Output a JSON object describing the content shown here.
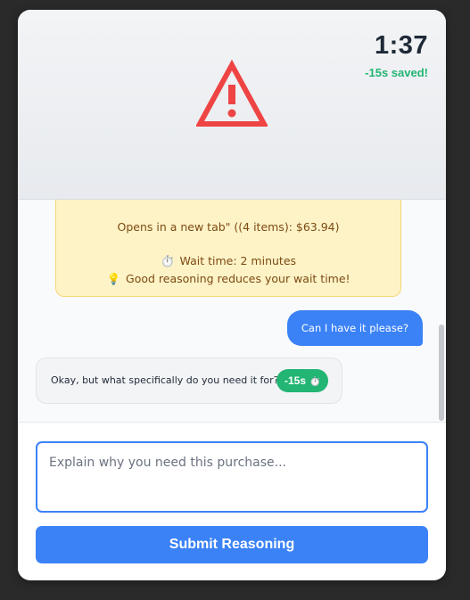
{
  "header": {
    "timer": "1:37",
    "saved": "-15s saved!",
    "icon": "warning-triangle-icon",
    "accent_color": "#ef4444"
  },
  "notice": {
    "line1": "Opens in a new tab\" ((4 items): $63.94)",
    "wait_icon": "⏱️",
    "wait_text": "Wait time: 2 minutes",
    "tip_icon": "💡",
    "tip_text": "Good reasoning reduces your wait time!"
  },
  "messages": {
    "user": "Can I have it please?",
    "bot": "Okay, but what specifically do you need it for?",
    "penalty_label": "-15s",
    "penalty_icon": "⏱️"
  },
  "composer": {
    "placeholder": "Explain why you need this purchase...",
    "submit_label": "Submit Reasoning"
  },
  "colors": {
    "primary": "#3b82f6",
    "success": "#22b573",
    "notice_bg": "#fef3c7",
    "notice_text": "#7c4a12"
  }
}
